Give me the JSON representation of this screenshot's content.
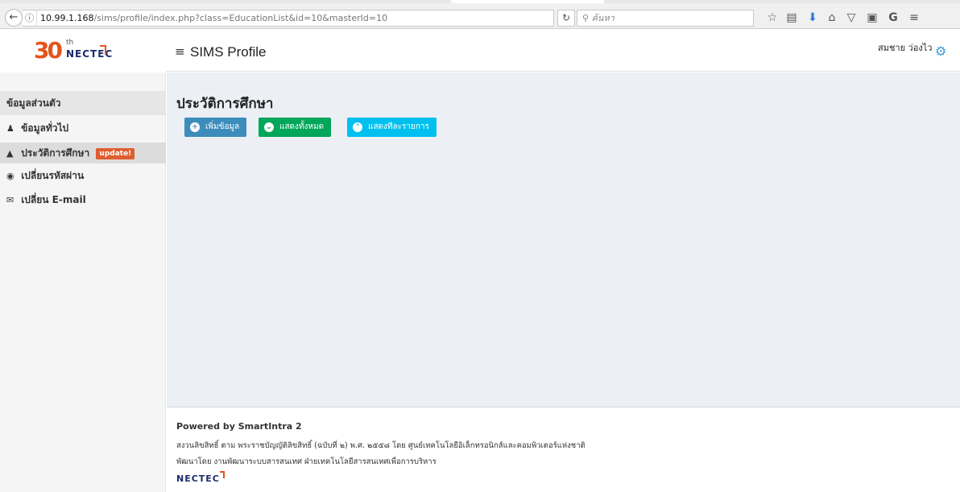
{
  "browser": {
    "url_host": "10.99.1.168",
    "url_path": "/sims/profile/index.php?class=EducationList&id=10&masterId=10",
    "search_placeholder": "ค้นหา"
  },
  "header": {
    "logo_number": "30",
    "logo_superscript": "th",
    "logo_brand": "NECTEC",
    "menu_icon": "≡",
    "title": "SIMS Profile",
    "user_name": "สมชาย ว่องไว"
  },
  "sidebar": {
    "heading": "ข้อมูลส่วนตัว",
    "items": [
      {
        "label": "ข้อมูลทั่วไป",
        "icon": "user-icon"
      },
      {
        "label": "ประวัติการศึกษา",
        "icon": "graduation-cap-icon",
        "badge": "update!"
      },
      {
        "label": "เปลี่ยนรหัสผ่าน",
        "icon": "lock-icon"
      },
      {
        "label": "เปลี่ยน E-mail",
        "icon": "envelope-icon"
      }
    ]
  },
  "main": {
    "title": "ประวัติการศึกษา",
    "buttons": {
      "add": "เพิ่มข้อมูล",
      "show_all": "แสดงทั้งหมด",
      "show_each": "แสดงทีละรายการ"
    }
  },
  "footer": {
    "powered": "Powered by SmartIntra 2",
    "copyright": "สงวนลิขสิทธิ์ ตาม พระราชบัญญัติลิขสิทธิ์ (ฉบับที่ ๒) พ.ศ. ๒๕๕๘ โดย ศูนย์เทคโนโลยีอิเล็กทรอนิกส์และคอมพิวเตอร์แห่งชาติ",
    "developer": "พัฒนาโดย งานพัฒนาระบบสารสนเทศ ฝ่ายเทคโนโลยีสารสนเทศเพื่อการบริหาร",
    "logo": "NECTEC"
  },
  "colors": {
    "primary": "#3c8dbc",
    "success": "#00a65a",
    "info": "#00c0ef",
    "badge": "#e05d2f",
    "content_bg": "#ecf0f5"
  }
}
